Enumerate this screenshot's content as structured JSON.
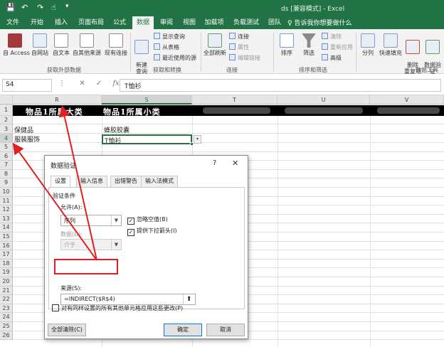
{
  "titlebar": {
    "title": "ds [兼容模式] - Excel",
    "save_icon": "save-icon",
    "undo_icon": "undo-icon",
    "redo_icon": "redo-icon",
    "touch_icon": "touch-mode-icon"
  },
  "tabs": [
    "文件",
    "开始",
    "插入",
    "页面布局",
    "公式",
    "数据",
    "审阅",
    "视图",
    "加载项",
    "负载测试",
    "团队"
  ],
  "active_tab": "数据",
  "tell_me": "♀ 告诉我你想要做什么",
  "ribbon": {
    "get_external": {
      "group": "获取外部数据",
      "buttons": [
        "自 Access",
        "自网站",
        "自文本",
        "自其他来源",
        "现有连接"
      ]
    },
    "get_transform": {
      "group": "获取和转换",
      "new_query": "新建\n查询",
      "items": [
        "显示查询",
        "从表格",
        "最近使用的源"
      ]
    },
    "connections": {
      "group": "连接",
      "refresh_all": "全部刷新",
      "items": [
        "连接",
        "属性",
        "编辑链接"
      ]
    },
    "sort_filter": {
      "group": "排序和筛选",
      "sort": "排序",
      "filter": "筛选",
      "items": [
        "清除",
        "重新应用",
        "高级"
      ]
    },
    "data_tools": {
      "group": "数据工具",
      "buttons": [
        "分列",
        "快速填充",
        "删除\n重复项",
        "数据验\n证"
      ]
    }
  },
  "formula_bar": {
    "name_box": "S4",
    "cancel": "✕",
    "enter": "✓",
    "fx": "fx",
    "value": "T恤衫"
  },
  "grid": {
    "columns": [
      "R",
      "S",
      "T",
      "U",
      "V"
    ],
    "selected_column": "S",
    "rows": [
      "1",
      "2",
      "3",
      "4",
      "5",
      "6",
      "7",
      "8",
      "9",
      "10",
      "11",
      "12",
      "13",
      "14",
      "15",
      "16",
      "17",
      "18",
      "19",
      "20",
      "21",
      "22",
      "23",
      "24",
      "25",
      "26"
    ],
    "selected_row": "4",
    "header_r": "物品1所属大类",
    "header_s": "物品1所属小类",
    "r3": "保健品",
    "s3": "蜂胶胶囊",
    "r4": "服装服饰",
    "s4": "T恤衫",
    "dropdown_arrow": "▾"
  },
  "dialog": {
    "title": "数据验证",
    "help": "?",
    "close": "✕",
    "tabs": [
      "设置",
      "输入信息",
      "出错警告",
      "输入法模式"
    ],
    "active_tab": "设置",
    "criteria_label": "验证条件",
    "allow_label": "允许(A):",
    "allow_value": "序列",
    "ignore_blank": "忽略空值(B)",
    "dropdown_arrow_opt": "提供下拉箭头(I)",
    "data_label": "数据(D):",
    "data_value": "介于",
    "source_label": "来源(S):",
    "source_value": "=INDIRECT($R$4)",
    "source_button": "⬆",
    "apply_all": "对有同样设置的所有其他单元格应用这些更改(P)",
    "clear_all": "全部清除(C)",
    "ok": "确定",
    "cancel": "取消"
  },
  "colors": {
    "excel_green": "#217346",
    "annotation_red": "#e02020"
  }
}
